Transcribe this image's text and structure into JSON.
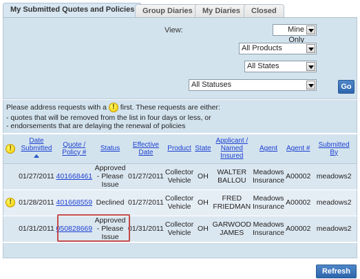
{
  "tabs": [
    {
      "label": "My Submitted Quotes and Policies",
      "active": true
    },
    {
      "label": "Group Diaries",
      "active": false
    },
    {
      "label": "My Diaries",
      "active": false
    },
    {
      "label": "Closed",
      "active": false
    }
  ],
  "filters": {
    "view_label": "View:",
    "view_value": "Mine Only",
    "products_value": "All Products",
    "states_value": "All States",
    "statuses_value": "All Statuses",
    "go_label": "Go"
  },
  "notice": {
    "line1_pre": "Please address requests with a",
    "line1_post": "first. These requests are either:",
    "line2": "- quotes that will be removed from the list in four days or less, or",
    "line3": "- endorsements that are delaying the renewal of policies",
    "alert_glyph": "!"
  },
  "table": {
    "headers": {
      "alert": "!",
      "date_submitted": [
        "Date",
        "Submitted"
      ],
      "quote_policy": [
        "Quote /",
        "Policy #"
      ],
      "status": "Status",
      "effective_date": [
        "Effective",
        "Date"
      ],
      "product": "Product",
      "state": "State",
      "applicant": [
        "Applicant /",
        "Named",
        "Insured"
      ],
      "agent": "Agent",
      "agent_num": "Agent #",
      "submitted_by": [
        "Submitted",
        "By"
      ]
    },
    "rows": [
      {
        "alert": "",
        "date_submitted": "01/27/2011",
        "quote": "401668461",
        "status": [
          "Approved",
          "- Please",
          "Issue"
        ],
        "effective": "01/27/2011",
        "product": [
          "Collector",
          "Vehicle"
        ],
        "state": "OH",
        "applicant": [
          "WALTER",
          "BALLOU"
        ],
        "agent": [
          "Meadows",
          "Insurance"
        ],
        "agent_num": "A00002",
        "submitted_by": "meadows2"
      },
      {
        "alert": "!",
        "date_submitted": "01/28/2011",
        "quote": "401668559",
        "status": [
          "Declined"
        ],
        "effective": "01/27/2011",
        "product": [
          "Collector",
          "Vehicle"
        ],
        "state": "OH",
        "applicant": [
          "FRED",
          "FRIEDMAN"
        ],
        "agent": [
          "Meadows",
          "Insurance"
        ],
        "agent_num": "A00002",
        "submitted_by": "meadows2"
      },
      {
        "alert": "",
        "date_submitted": "01/31/2011",
        "quote": "050828669",
        "status": [
          "Approved",
          "- Please",
          "Issue"
        ],
        "effective": "01/31/2011",
        "product": [
          "Collector",
          "Vehicle"
        ],
        "state": "OH",
        "applicant": [
          "GARWOOD",
          "JAMES"
        ],
        "agent": [
          "Meadows",
          "Insurance"
        ],
        "agent_num": "A00002",
        "submitted_by": "meadows2"
      }
    ]
  },
  "refresh_label": "Refresh",
  "colors": {
    "panel": "#d3e3ee",
    "link": "#1a3fd0",
    "button": "#2d66ad",
    "highlight": "#c24a4a",
    "alert": "#f2c400"
  }
}
